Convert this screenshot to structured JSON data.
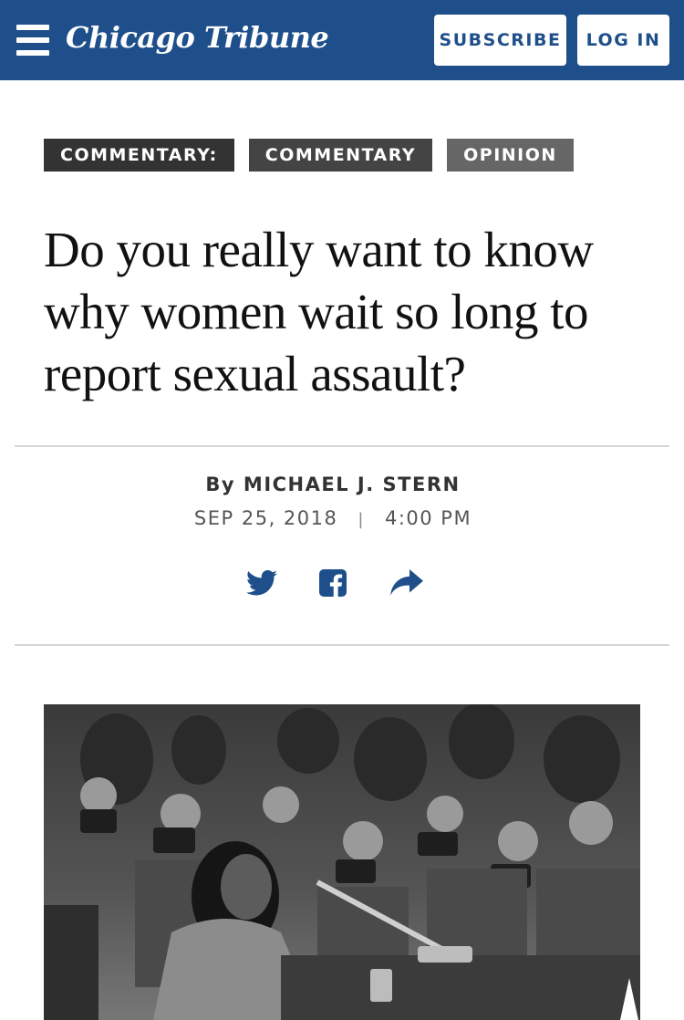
{
  "header": {
    "logo_text": "Chicago Tribune",
    "subscribe_label": "SUBSCRIBE",
    "login_label": "LOG IN",
    "brand_color": "#1f4f8b",
    "menu_icon": "hamburger-icon"
  },
  "tags": [
    {
      "label": "COMMENTARY:"
    },
    {
      "label": "COMMENTARY"
    },
    {
      "label": "OPINION"
    }
  ],
  "article": {
    "headline": "Do you really want to know why women wait so long to report sexual assault?",
    "byline": "By MICHAEL J. STERN",
    "date": "SEP 25, 2018",
    "separator": "|",
    "time": "4:00 PM"
  },
  "share": {
    "icons": [
      "twitter-icon",
      "facebook-icon",
      "share-icon"
    ],
    "icon_color": "#1f4f8b"
  }
}
